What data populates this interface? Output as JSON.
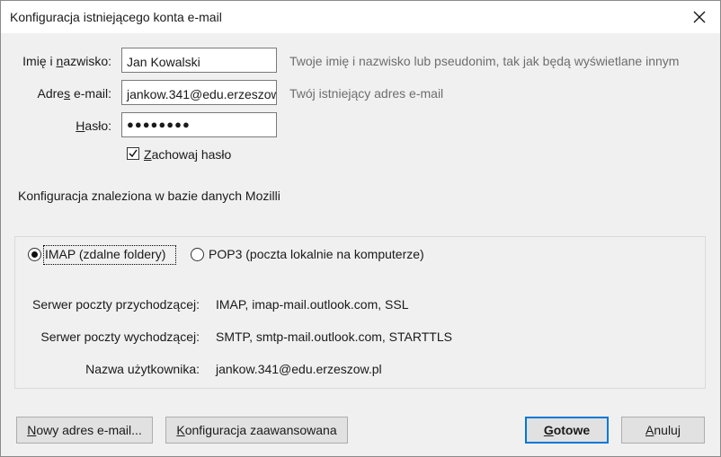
{
  "window": {
    "title": "Konfiguracja istniejącego konta e-mail"
  },
  "form": {
    "name": {
      "label_pre": "Imię i ",
      "label_accel": "n",
      "label_post": "azwisko:",
      "value": "Jan Kowalski",
      "hint": "Twoje imię i nazwisko lub pseudonim, tak jak będą wyświetlane innym"
    },
    "email": {
      "label_pre": "Adre",
      "label_accel": "s",
      "label_post": " e-mail:",
      "value": "jankow.341@edu.erzeszow.pl",
      "hint": "Twój istniejący adres e-mail"
    },
    "password": {
      "label_pre": "",
      "label_accel": "H",
      "label_post": "asło:",
      "masked": "●●●●●●●●"
    },
    "remember": {
      "checked": true,
      "label_accel": "Z",
      "label_post": "achowaj hasło"
    }
  },
  "status_text": "Konfiguracja znaleziona w bazie danych Mozilli",
  "protocols": [
    {
      "label": "IMAP (zdalne foldery)",
      "selected": true
    },
    {
      "label": "POP3 (poczta lokalnie na komputerze)",
      "selected": false
    }
  ],
  "servers": [
    {
      "label": "Serwer poczty przychodzącej:",
      "value": "IMAP, imap-mail.outlook.com, SSL"
    },
    {
      "label": "Serwer poczty wychodzącej:",
      "value": "SMTP, smtp-mail.outlook.com, STARTTLS"
    },
    {
      "label": "Nazwa użytkownika:",
      "value": "jankow.341@edu.erzeszow.pl"
    }
  ],
  "buttons": {
    "new_address": {
      "accel": "N",
      "rest": "owy adres e-mail..."
    },
    "advanced": {
      "accel": "K",
      "rest": "onfiguracja zaawansowana"
    },
    "done": {
      "accel": "G",
      "rest": "otowe"
    },
    "cancel": {
      "accel": "A",
      "rest": "nuluj"
    }
  },
  "icons": {
    "close": "close-icon",
    "check": "checkmark-icon"
  },
  "colors": {
    "accent": "#0078d7",
    "hint_text": "#6d6d6d",
    "dialog_bg": "#f0f0f0"
  }
}
